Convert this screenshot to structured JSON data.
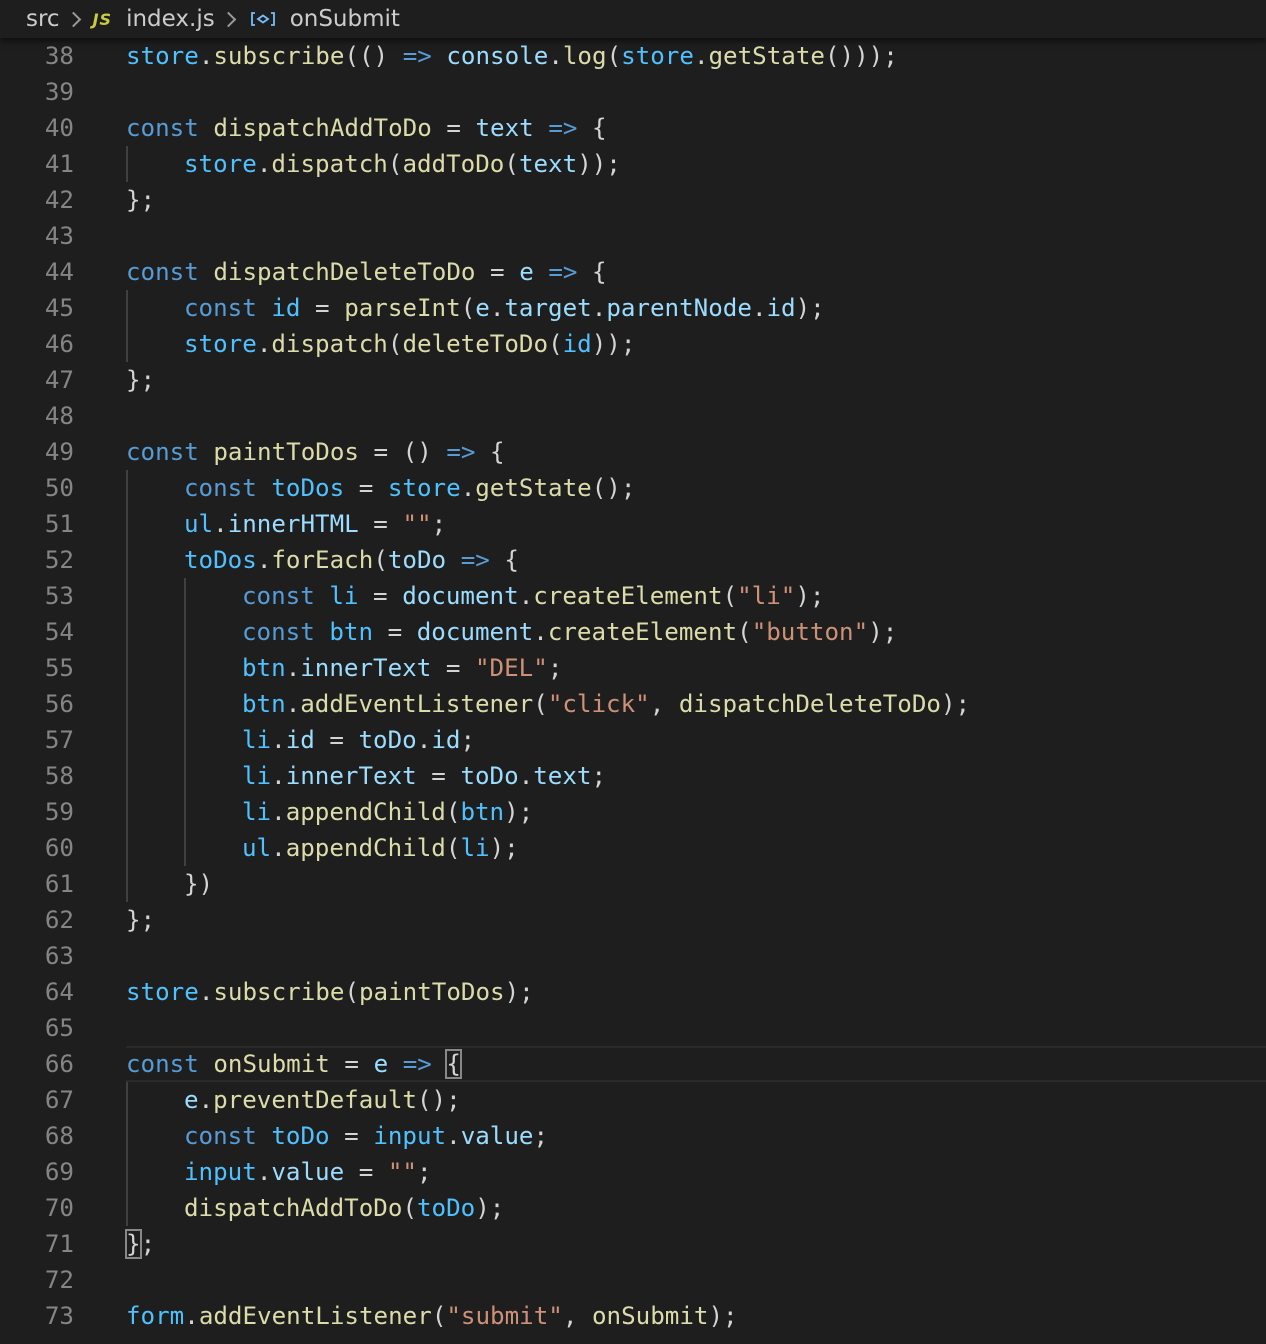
{
  "breadcrumb": {
    "folder": "src",
    "file_badge": "JS",
    "file": "index.js",
    "symbol": "onSubmit",
    "symbol_icon": "variable-symbol-icon"
  },
  "colors": {
    "background": "#1e1e1e",
    "line_number": "#858585",
    "keyword": "#569cd6",
    "variable": "#4fc1ff",
    "property": "#9cdcfe",
    "function": "#dcdcaa",
    "string": "#ce9178",
    "punctuation": "#d4d4d4"
  },
  "editor": {
    "current_line": 66,
    "lines": [
      {
        "n": 38,
        "indent": 0,
        "tokens": [
          [
            "v",
            "store"
          ],
          [
            "p",
            "."
          ],
          [
            "f",
            "subscribe"
          ],
          [
            "p",
            "(() "
          ],
          [
            "k",
            "=>"
          ],
          [
            "p",
            " "
          ],
          [
            "vs",
            "console"
          ],
          [
            "p",
            "."
          ],
          [
            "f",
            "log"
          ],
          [
            "p",
            "("
          ],
          [
            "v",
            "store"
          ],
          [
            "p",
            "."
          ],
          [
            "f",
            "getState"
          ],
          [
            "p",
            "()));"
          ]
        ]
      },
      {
        "n": 39,
        "indent": 0,
        "tokens": []
      },
      {
        "n": 40,
        "indent": 0,
        "tokens": [
          [
            "k",
            "const"
          ],
          [
            "p",
            " "
          ],
          [
            "f",
            "dispatchAddToDo"
          ],
          [
            "p",
            " = "
          ],
          [
            "vs",
            "text"
          ],
          [
            "p",
            " "
          ],
          [
            "k",
            "=>"
          ],
          [
            "p",
            " {"
          ]
        ]
      },
      {
        "n": 41,
        "indent": 1,
        "tokens": [
          [
            "v",
            "store"
          ],
          [
            "p",
            "."
          ],
          [
            "f",
            "dispatch"
          ],
          [
            "p",
            "("
          ],
          [
            "f",
            "addToDo"
          ],
          [
            "p",
            "("
          ],
          [
            "vs",
            "text"
          ],
          [
            "p",
            "));"
          ]
        ]
      },
      {
        "n": 42,
        "indent": 0,
        "tokens": [
          [
            "p",
            "};"
          ]
        ]
      },
      {
        "n": 43,
        "indent": 0,
        "tokens": []
      },
      {
        "n": 44,
        "indent": 0,
        "tokens": [
          [
            "k",
            "const"
          ],
          [
            "p",
            " "
          ],
          [
            "f",
            "dispatchDeleteToDo"
          ],
          [
            "p",
            " = "
          ],
          [
            "vs",
            "e"
          ],
          [
            "p",
            " "
          ],
          [
            "k",
            "=>"
          ],
          [
            "p",
            " {"
          ]
        ]
      },
      {
        "n": 45,
        "indent": 1,
        "tokens": [
          [
            "k",
            "const"
          ],
          [
            "p",
            " "
          ],
          [
            "v",
            "id"
          ],
          [
            "p",
            " = "
          ],
          [
            "f",
            "parseInt"
          ],
          [
            "p",
            "("
          ],
          [
            "vs",
            "e"
          ],
          [
            "p",
            "."
          ],
          [
            "vs",
            "target"
          ],
          [
            "p",
            "."
          ],
          [
            "vs",
            "parentNode"
          ],
          [
            "p",
            "."
          ],
          [
            "vs",
            "id"
          ],
          [
            "p",
            ");"
          ]
        ]
      },
      {
        "n": 46,
        "indent": 1,
        "tokens": [
          [
            "v",
            "store"
          ],
          [
            "p",
            "."
          ],
          [
            "f",
            "dispatch"
          ],
          [
            "p",
            "("
          ],
          [
            "f",
            "deleteToDo"
          ],
          [
            "p",
            "("
          ],
          [
            "v",
            "id"
          ],
          [
            "p",
            "));"
          ]
        ]
      },
      {
        "n": 47,
        "indent": 0,
        "tokens": [
          [
            "p",
            "};"
          ]
        ]
      },
      {
        "n": 48,
        "indent": 0,
        "tokens": []
      },
      {
        "n": 49,
        "indent": 0,
        "tokens": [
          [
            "k",
            "const"
          ],
          [
            "p",
            " "
          ],
          [
            "f",
            "paintToDos"
          ],
          [
            "p",
            " = () "
          ],
          [
            "k",
            "=>"
          ],
          [
            "p",
            " {"
          ]
        ]
      },
      {
        "n": 50,
        "indent": 1,
        "tokens": [
          [
            "k",
            "const"
          ],
          [
            "p",
            " "
          ],
          [
            "v",
            "toDos"
          ],
          [
            "p",
            " = "
          ],
          [
            "v",
            "store"
          ],
          [
            "p",
            "."
          ],
          [
            "f",
            "getState"
          ],
          [
            "p",
            "();"
          ]
        ]
      },
      {
        "n": 51,
        "indent": 1,
        "tokens": [
          [
            "v",
            "ul"
          ],
          [
            "p",
            "."
          ],
          [
            "vs",
            "innerHTML"
          ],
          [
            "p",
            " = "
          ],
          [
            "s",
            "\"\""
          ],
          [
            "p",
            ";"
          ]
        ]
      },
      {
        "n": 52,
        "indent": 1,
        "tokens": [
          [
            "v",
            "toDos"
          ],
          [
            "p",
            "."
          ],
          [
            "f",
            "forEach"
          ],
          [
            "p",
            "("
          ],
          [
            "vs",
            "toDo"
          ],
          [
            "p",
            " "
          ],
          [
            "k",
            "=>"
          ],
          [
            "p",
            " {"
          ]
        ]
      },
      {
        "n": 53,
        "indent": 2,
        "tokens": [
          [
            "k",
            "const"
          ],
          [
            "p",
            " "
          ],
          [
            "v",
            "li"
          ],
          [
            "p",
            " = "
          ],
          [
            "vs",
            "document"
          ],
          [
            "p",
            "."
          ],
          [
            "f",
            "createElement"
          ],
          [
            "p",
            "("
          ],
          [
            "s",
            "\"li\""
          ],
          [
            "p",
            ");"
          ]
        ]
      },
      {
        "n": 54,
        "indent": 2,
        "tokens": [
          [
            "k",
            "const"
          ],
          [
            "p",
            " "
          ],
          [
            "v",
            "btn"
          ],
          [
            "p",
            " = "
          ],
          [
            "vs",
            "document"
          ],
          [
            "p",
            "."
          ],
          [
            "f",
            "createElement"
          ],
          [
            "p",
            "("
          ],
          [
            "s",
            "\"button\""
          ],
          [
            "p",
            ");"
          ]
        ]
      },
      {
        "n": 55,
        "indent": 2,
        "tokens": [
          [
            "v",
            "btn"
          ],
          [
            "p",
            "."
          ],
          [
            "vs",
            "innerText"
          ],
          [
            "p",
            " = "
          ],
          [
            "s",
            "\"DEL\""
          ],
          [
            "p",
            ";"
          ]
        ]
      },
      {
        "n": 56,
        "indent": 2,
        "tokens": [
          [
            "v",
            "btn"
          ],
          [
            "p",
            "."
          ],
          [
            "f",
            "addEventListener"
          ],
          [
            "p",
            "("
          ],
          [
            "s",
            "\"click\""
          ],
          [
            "p",
            ", "
          ],
          [
            "f",
            "dispatchDeleteToDo"
          ],
          [
            "p",
            ");"
          ]
        ]
      },
      {
        "n": 57,
        "indent": 2,
        "tokens": [
          [
            "v",
            "li"
          ],
          [
            "p",
            "."
          ],
          [
            "vs",
            "id"
          ],
          [
            "p",
            " = "
          ],
          [
            "vs",
            "toDo"
          ],
          [
            "p",
            "."
          ],
          [
            "vs",
            "id"
          ],
          [
            "p",
            ";"
          ]
        ]
      },
      {
        "n": 58,
        "indent": 2,
        "tokens": [
          [
            "v",
            "li"
          ],
          [
            "p",
            "."
          ],
          [
            "vs",
            "innerText"
          ],
          [
            "p",
            " = "
          ],
          [
            "vs",
            "toDo"
          ],
          [
            "p",
            "."
          ],
          [
            "vs",
            "text"
          ],
          [
            "p",
            ";"
          ]
        ]
      },
      {
        "n": 59,
        "indent": 2,
        "tokens": [
          [
            "v",
            "li"
          ],
          [
            "p",
            "."
          ],
          [
            "f",
            "appendChild"
          ],
          [
            "p",
            "("
          ],
          [
            "v",
            "btn"
          ],
          [
            "p",
            ");"
          ]
        ]
      },
      {
        "n": 60,
        "indent": 2,
        "tokens": [
          [
            "v",
            "ul"
          ],
          [
            "p",
            "."
          ],
          [
            "f",
            "appendChild"
          ],
          [
            "p",
            "("
          ],
          [
            "v",
            "li"
          ],
          [
            "p",
            ");"
          ]
        ]
      },
      {
        "n": 61,
        "indent": 1,
        "tokens": [
          [
            "p",
            "})"
          ]
        ]
      },
      {
        "n": 62,
        "indent": 0,
        "tokens": [
          [
            "p",
            "};"
          ]
        ]
      },
      {
        "n": 63,
        "indent": 0,
        "tokens": []
      },
      {
        "n": 64,
        "indent": 0,
        "tokens": [
          [
            "v",
            "store"
          ],
          [
            "p",
            "."
          ],
          [
            "f",
            "subscribe"
          ],
          [
            "p",
            "("
          ],
          [
            "f",
            "paintToDos"
          ],
          [
            "p",
            ");"
          ]
        ]
      },
      {
        "n": 65,
        "indent": 0,
        "tokens": []
      },
      {
        "n": 66,
        "indent": 0,
        "tokens": [
          [
            "k",
            "const"
          ],
          [
            "p",
            " "
          ],
          [
            "f",
            "onSubmit"
          ],
          [
            "p",
            " = "
          ],
          [
            "vs",
            "e"
          ],
          [
            "p",
            " "
          ],
          [
            "k",
            "=>"
          ],
          [
            "p",
            " "
          ],
          [
            "m",
            "{"
          ]
        ]
      },
      {
        "n": 67,
        "indent": 1,
        "tokens": [
          [
            "vs",
            "e"
          ],
          [
            "p",
            "."
          ],
          [
            "f",
            "preventDefault"
          ],
          [
            "p",
            "();"
          ]
        ]
      },
      {
        "n": 68,
        "indent": 1,
        "tokens": [
          [
            "k",
            "const"
          ],
          [
            "p",
            " "
          ],
          [
            "v",
            "toDo"
          ],
          [
            "p",
            " = "
          ],
          [
            "v",
            "input"
          ],
          [
            "p",
            "."
          ],
          [
            "vs",
            "value"
          ],
          [
            "p",
            ";"
          ]
        ]
      },
      {
        "n": 69,
        "indent": 1,
        "tokens": [
          [
            "v",
            "input"
          ],
          [
            "p",
            "."
          ],
          [
            "vs",
            "value"
          ],
          [
            "p",
            " = "
          ],
          [
            "s",
            "\"\""
          ],
          [
            "p",
            ";"
          ]
        ]
      },
      {
        "n": 70,
        "indent": 1,
        "tokens": [
          [
            "f",
            "dispatchAddToDo"
          ],
          [
            "p",
            "("
          ],
          [
            "v",
            "toDo"
          ],
          [
            "p",
            ");"
          ]
        ]
      },
      {
        "n": 71,
        "indent": 0,
        "tokens": [
          [
            "m",
            "}"
          ],
          [
            "p",
            ";"
          ]
        ]
      },
      {
        "n": 72,
        "indent": 0,
        "tokens": []
      },
      {
        "n": 73,
        "indent": 0,
        "tokens": [
          [
            "v",
            "form"
          ],
          [
            "p",
            "."
          ],
          [
            "f",
            "addEventListener"
          ],
          [
            "p",
            "("
          ],
          [
            "s",
            "\"submit\""
          ],
          [
            "p",
            ", "
          ],
          [
            "f",
            "onSubmit"
          ],
          [
            "p",
            ");"
          ]
        ]
      }
    ]
  }
}
